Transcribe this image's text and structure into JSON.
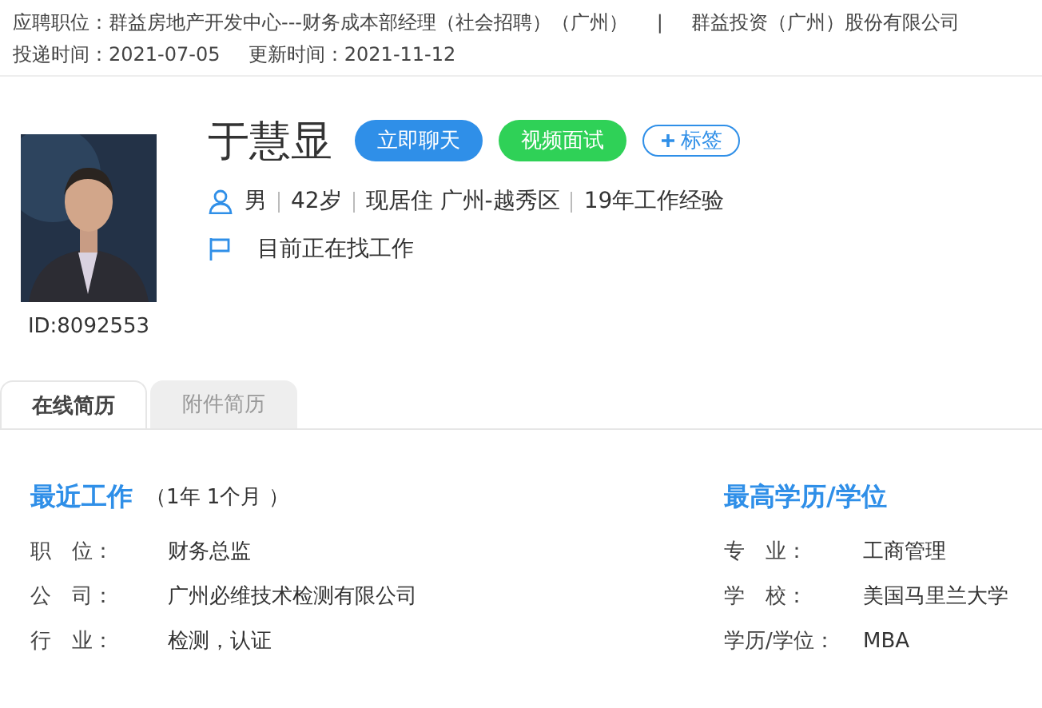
{
  "application": {
    "position_label": "应聘职位：",
    "position": "群益房地产开发中心---财务成本部经理（社会招聘）（广州）",
    "separator": "|",
    "company": "群益投资（广州）股份有限公司",
    "sent_label": "投递时间：",
    "sent": "2021-07-05",
    "updated_label": "更新时间：",
    "updated": "2021-11-12"
  },
  "profile": {
    "id": "ID:8092553",
    "name": "于慧显",
    "actions": [
      {
        "label": "立即聊天",
        "kind": "chat"
      },
      {
        "label": "视频面试",
        "kind": "video"
      },
      {
        "label": "标签",
        "kind": "tag"
      }
    ],
    "facts": [
      "男",
      "42岁",
      "现居住 广州-越秀区",
      "19年工作经验"
    ],
    "status": "目前正在找工作"
  },
  "tabs": [
    {
      "label": "在线简历",
      "selected": true
    },
    {
      "label": "附件简历",
      "selected": false
    }
  ],
  "recent_work": {
    "title": "最近工作",
    "duration": "（1年 1个月 ）",
    "fields": [
      {
        "label": "职　位：",
        "value": "财务总监"
      },
      {
        "label": "公　司：",
        "value": "广州必维技术检测有限公司"
      },
      {
        "label": "行　业：",
        "value": "检测，认证"
      }
    ]
  },
  "education": {
    "title": "最高学历/学位",
    "fields": [
      {
        "label": "专　业：",
        "value": "工商管理"
      },
      {
        "label": "学　校：",
        "value": "美国马里兰大学"
      },
      {
        "label": "学历/学位：",
        "value": "MBA"
      }
    ]
  }
}
